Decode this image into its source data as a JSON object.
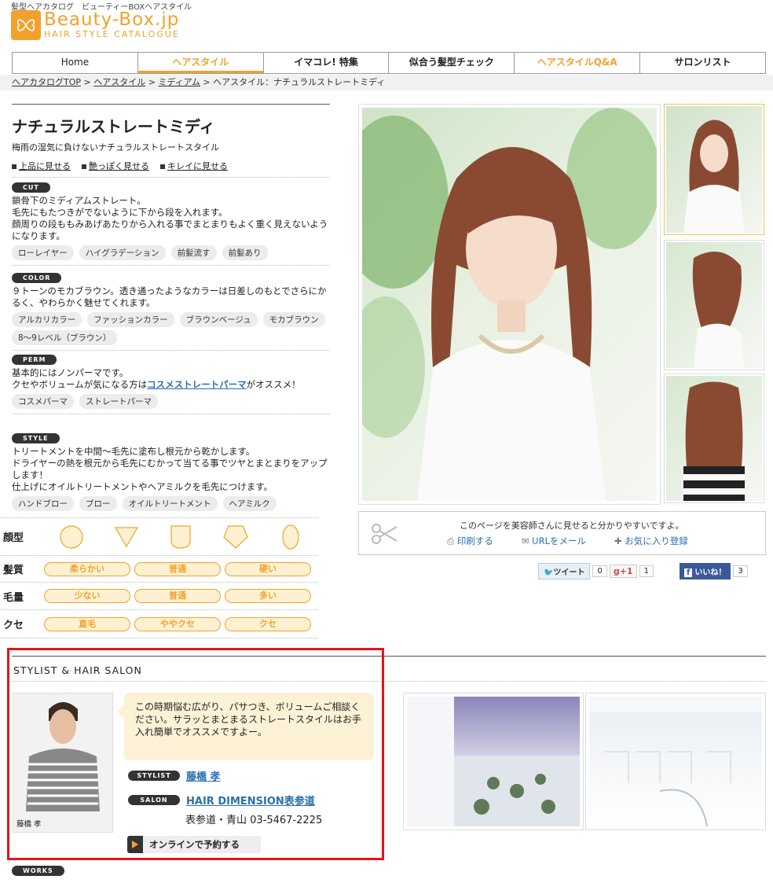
{
  "header": {
    "tagline": "髪型ヘアカタログ　ビューティーBOXヘアスタイル",
    "logo_main": "Beauty-Box.jp",
    "logo_sub": "HAIR STYLE CATALOGUE"
  },
  "nav": {
    "items": [
      "Home",
      "ヘアスタイル",
      "イマコレ! 特集",
      "似合う髪型チェック",
      "ヘアスタイルQ&A",
      "サロンリスト"
    ]
  },
  "breadcrumb": {
    "links": [
      "ヘアカタログTOP",
      "ヘアスタイル",
      "ミディアム"
    ],
    "sep": " > ",
    "current": "ヘアスタイル：ナチュラルストレートミディ"
  },
  "style": {
    "title": "ナチュラルストレートミディ",
    "subtitle": "梅雨の湿気に負けないナチュラルストレートスタイル",
    "view_links": [
      "上品に見せる",
      "艶っぽく見せる",
      "キレイに見せる"
    ]
  },
  "sections": {
    "cut": {
      "label": "CUT",
      "lines": [
        "鎖骨下のミディアムストレート。",
        "毛先にもたつきがでないように下から段を入れます。",
        "顔周りの段ももみあげあたりから入れる事でまとまりもよく重く見えないようになります。"
      ],
      "tags": [
        "ローレイヤー",
        "ハイグラデーション",
        "前髪流す",
        "前髪あり"
      ]
    },
    "color": {
      "label": "COLOR",
      "lines": [
        "９トーンのモカブラウン。透き通ったようなカラーは日差しのもとでさらにかるく、やわらかく魅せてくれます。"
      ],
      "tags": [
        "アルカリカラー",
        "ファッションカラー",
        "ブラウンベージュ",
        "モカブラウン",
        "8〜9レベル（ブラウン）"
      ]
    },
    "perm": {
      "label": "PERM",
      "line1": "基本的にはノンパーマです。",
      "line2_pre": "クセやボリュームが気になる方は",
      "line2_link": "コスメストレートパーマ",
      "line2_post": "がオススメ！",
      "tags": [
        "コスメパーマ",
        "ストレートパーマ"
      ]
    },
    "style": {
      "label": "STYLE",
      "lines": [
        "トリートメントを中間〜毛先に塗布し根元から乾かします。",
        "ドライヤーの熱を根元から毛先にむかって当てる事でツヤとまとまりをアップします！",
        "仕上げにオイルトリートメントやヘアミルクを毛先につけます。"
      ],
      "tags": [
        "ハンドブロー",
        "ブロー",
        "オイルトリートメント",
        "ヘアミルク"
      ]
    }
  },
  "properties": {
    "face_label": "顔型",
    "hair_label": "髪質",
    "hair_opts": [
      "柔らかい",
      "普通",
      "硬い"
    ],
    "volume_label": "毛量",
    "volume_opts": [
      "少ない",
      "普通",
      "多い"
    ],
    "curl_label": "クセ",
    "curl_opts": [
      "直毛",
      "ややクセ",
      "クセ"
    ]
  },
  "share": {
    "message": "このページを美容師さんに見せると分かりやすいですよ。",
    "print": "印刷する",
    "mail": "URLをメール",
    "favorite": "お気に入り登録",
    "tweet": "ツイート",
    "tweet_count": "0",
    "gplus": "g+1",
    "gplus_count": "1",
    "like": "いいね！",
    "like_count": "3"
  },
  "stylist": {
    "heading": "STYLIST & HAIR SALON",
    "comment": "この時期悩む広がり、パサつき、ボリュームご相談ください。サラッとまとまるストレートスタイルはお手入れ簡単でオススメですよー。",
    "photo_name": "藤橋 孝",
    "stylist_label": "STYLIST",
    "stylist_name": "藤橋 孝",
    "salon_label": "SALON",
    "salon_name": "HAIR DIMENSION表参道",
    "address": "表参道・青山 03-5467-2225",
    "reserve": "オンラインで予約する"
  },
  "works_label": "WORKS",
  "colors": {
    "accent": "#f2a22c",
    "link": "#2a6fb3",
    "highlight": "#e4141b"
  }
}
